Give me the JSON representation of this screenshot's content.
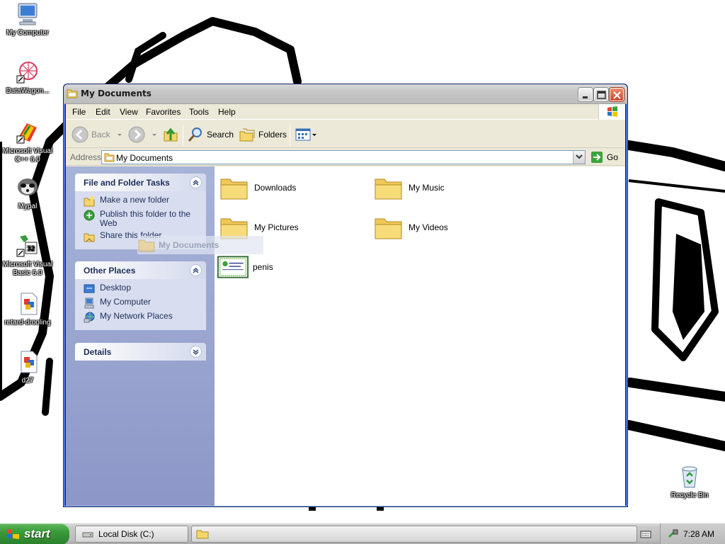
{
  "desktop": {
    "icons": [
      {
        "label": "My Computer",
        "icon": "my-computer-icon"
      },
      {
        "label": "DataWagon...",
        "icon": "datawagon-icon"
      },
      {
        "label": "Microsoft Visual C++ 6.0",
        "icon": "visual-cpp-icon"
      },
      {
        "label": "Mypal",
        "icon": "mypal-icon"
      },
      {
        "label": "Microsoft Visual Basic 6.0",
        "icon": "visual-basic-icon"
      },
      {
        "label": "retard-drooling",
        "icon": "image-file-icon"
      },
      {
        "label": "d27",
        "icon": "image-file-icon"
      },
      {
        "label": "Recycle Bin",
        "icon": "recycle-bin-icon"
      }
    ]
  },
  "window": {
    "title": "My Documents",
    "menu": [
      "File",
      "Edit",
      "View",
      "Favorites",
      "Tools",
      "Help"
    ],
    "toolbar": {
      "back": "Back",
      "search": "Search",
      "folders": "Folders"
    },
    "address": {
      "label": "Address",
      "value": "My Documents",
      "go": "Go"
    },
    "left_pane": {
      "file_folder_tasks": {
        "title": "File and Folder Tasks",
        "items": [
          "Make a new folder",
          "Publish this folder to the Web",
          "Share this folder"
        ]
      },
      "other_places": {
        "title": "Other Places",
        "items": [
          "Desktop",
          "My Computer",
          "My Network Places"
        ]
      },
      "details": {
        "title": "Details"
      }
    },
    "files": [
      {
        "name": "Downloads",
        "type": "folder"
      },
      {
        "name": "My Music",
        "type": "folder"
      },
      {
        "name": "My Pictures",
        "type": "folder"
      },
      {
        "name": "My Videos",
        "type": "folder"
      },
      {
        "name": "penis",
        "type": "certificate"
      }
    ],
    "drag_ghost": "My Documents"
  },
  "taskbar": {
    "start": "start",
    "tasks": [
      {
        "label": "Local Disk (C:)"
      },
      {
        "label": ""
      }
    ],
    "clock": "7:28 AM"
  }
}
